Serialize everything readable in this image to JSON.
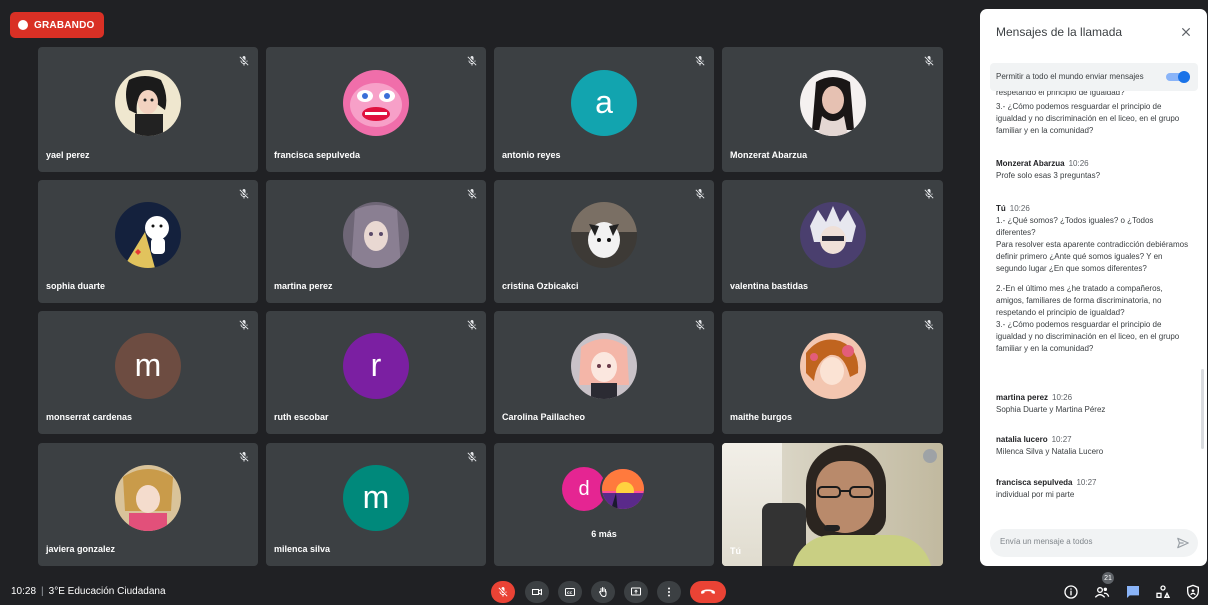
{
  "recording": {
    "label": "GRABANDO"
  },
  "tiles": [
    {
      "name": "yael perez"
    },
    {
      "name": "francisca sepulveda"
    },
    {
      "name": "antonio reyes",
      "letter": "a",
      "color": "#12a4af"
    },
    {
      "name": "Monzerat Abarzua"
    },
    {
      "name": "sophia duarte"
    },
    {
      "name": "martina perez"
    },
    {
      "name": "cristina Ozbicakci"
    },
    {
      "name": "valentina bastidas"
    },
    {
      "name": "monserrat cardenas",
      "letter": "m",
      "color": "#6d4c41"
    },
    {
      "name": "ruth escobar",
      "letter": "r",
      "color": "#7b1fa2"
    },
    {
      "name": "Carolina Paillacheo"
    },
    {
      "name": "maithe burgos"
    },
    {
      "name": "javiera gonzalez"
    },
    {
      "name": "milenca silva",
      "letter": "m",
      "color": "#00897b"
    }
  ],
  "more": {
    "letter": "d",
    "label": "6 más"
  },
  "self": {
    "name": "Tú"
  },
  "chat": {
    "title": "Mensajes de la llamada",
    "permit_label": "Permitir a todo el mundo enviar mensajes",
    "clipped": "respetando el principio de igualdad?",
    "intro_text": "3.- ¿Cómo podemos resguardar el principio de igualdad y no discriminación en el liceo, en el grupo familiar y en la comunidad?",
    "messages": [
      {
        "author": "Monzerat Abarzua",
        "time": "10:26",
        "text": "Profe solo esas 3 preguntas?"
      },
      {
        "author": "Tú",
        "time": "10:26",
        "text": "1.- ¿Qué somos? ¿Todos iguales? o ¿Todos diferentes?\nPara resolver esta aparente contradicción debiéramos definir primero ¿Ante qué somos iguales? Y en segundo lugar ¿En que somos diferentes?",
        "text2": "2.-En el último mes ¿he tratado a compañeros, amigos, familiares de forma discriminatoria, no respetando el principio de igualdad?\n3.- ¿Cómo podemos resguardar el principio de igualdad y no discriminación en el liceo, en el grupo familiar y en la comunidad?"
      },
      {
        "author": "martina perez",
        "time": "10:26",
        "text": "Sophia Duarte y Martina Pérez"
      },
      {
        "author": "natalia lucero",
        "time": "10:27",
        "text": "Milenca Silva y Natalia Lucero"
      },
      {
        "author": "francisca sepulveda",
        "time": "10:27",
        "text": "individual por mi parte"
      }
    ],
    "compose_placeholder": "Envía un mensaje a todos"
  },
  "bottom": {
    "time": "10:28",
    "meeting": "3°E Educación Ciudadana",
    "participants_count": "21"
  },
  "colors": {
    "record": "#d93025",
    "hangup": "#ea4335",
    "tile": "#3c4043",
    "background": "#202124",
    "accent": "#1a73e8"
  }
}
